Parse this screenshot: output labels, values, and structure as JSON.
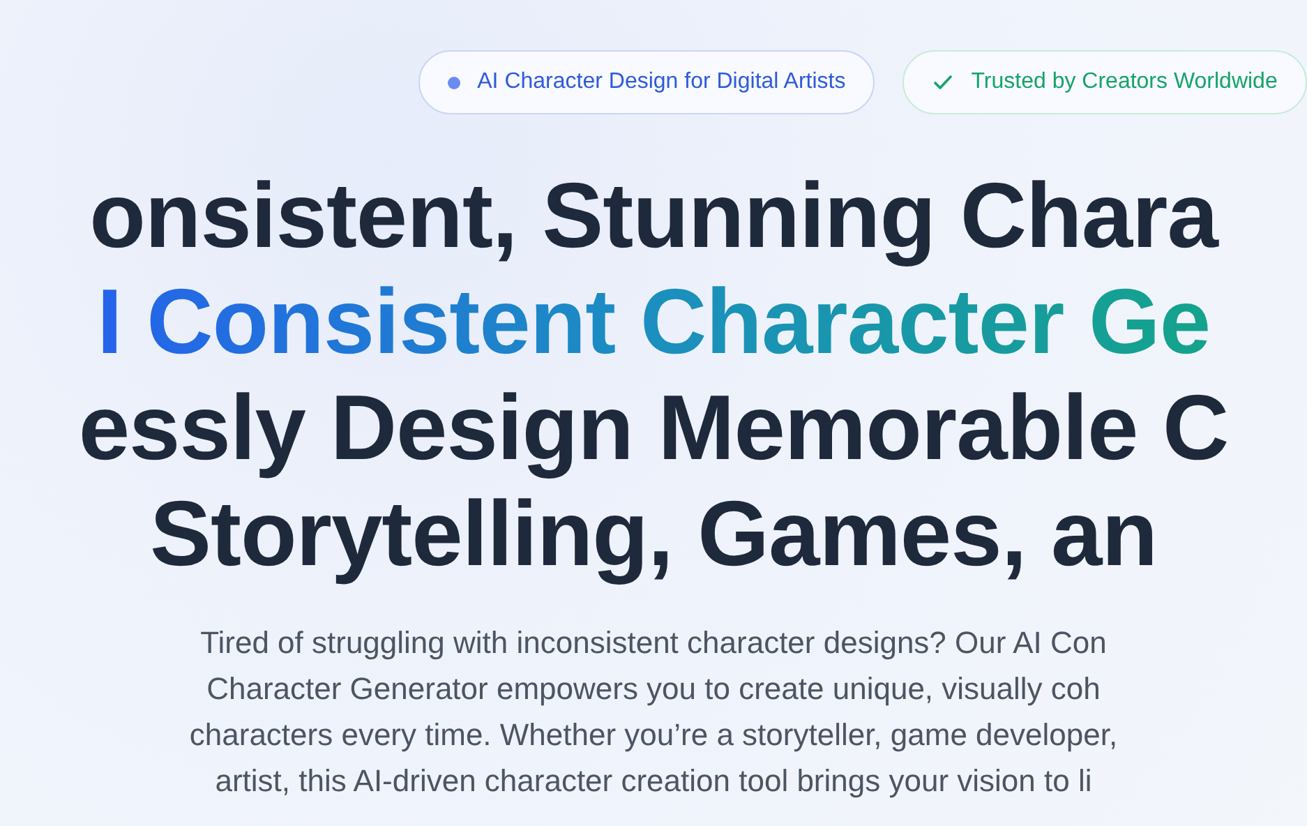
{
  "badges": [
    {
      "kind": "dot",
      "label": "AI Character Design for Digital Artists"
    },
    {
      "kind": "check",
      "label": "Trusted by Creators Worldwide"
    }
  ],
  "headline": [
    {
      "kind": "plain",
      "text": "onsistent, Stunning Chara"
    },
    {
      "kind": "gradient",
      "text": "I Consistent Character Ge"
    },
    {
      "kind": "plain",
      "text": "essly Design Memorable C"
    },
    {
      "kind": "plain",
      "text": "Storytelling, Games, an"
    }
  ],
  "description": [
    "Tired of struggling with inconsistent character designs? Our AI Con",
    "Character Generator empowers you to create unique, visually coh",
    "characters every time. Whether you’re a storyteller, game developer,",
    "artist, this AI-driven character creation tool brings your vision to li"
  ]
}
